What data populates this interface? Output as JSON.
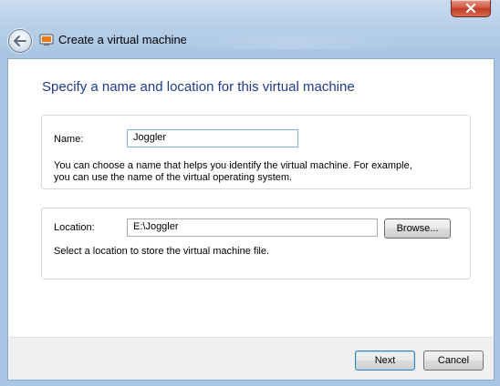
{
  "window": {
    "title": "Create a virtual machine"
  },
  "icons": {
    "back": "back-arrow-icon",
    "app": "virtual-machine-icon",
    "close": "close-icon"
  },
  "colors": {
    "heading": "#1e3d8f",
    "close_button": "#c33c25",
    "default_button_border": "#3c7fb1"
  },
  "page": {
    "heading": "Specify a name and location for this virtual machine"
  },
  "name_group": {
    "label": "Name:",
    "value": "Joggler",
    "help_line1": "You can choose a name that helps you identify the virtual machine. For example,",
    "help_line2": "you can use the name of the virtual operating system."
  },
  "location_group": {
    "label": "Location:",
    "value": "E:\\Joggler",
    "browse_label": "Browse...",
    "help": "Select a location to store the virtual machine file."
  },
  "footer": {
    "next_label": "Next",
    "cancel_label": "Cancel"
  }
}
